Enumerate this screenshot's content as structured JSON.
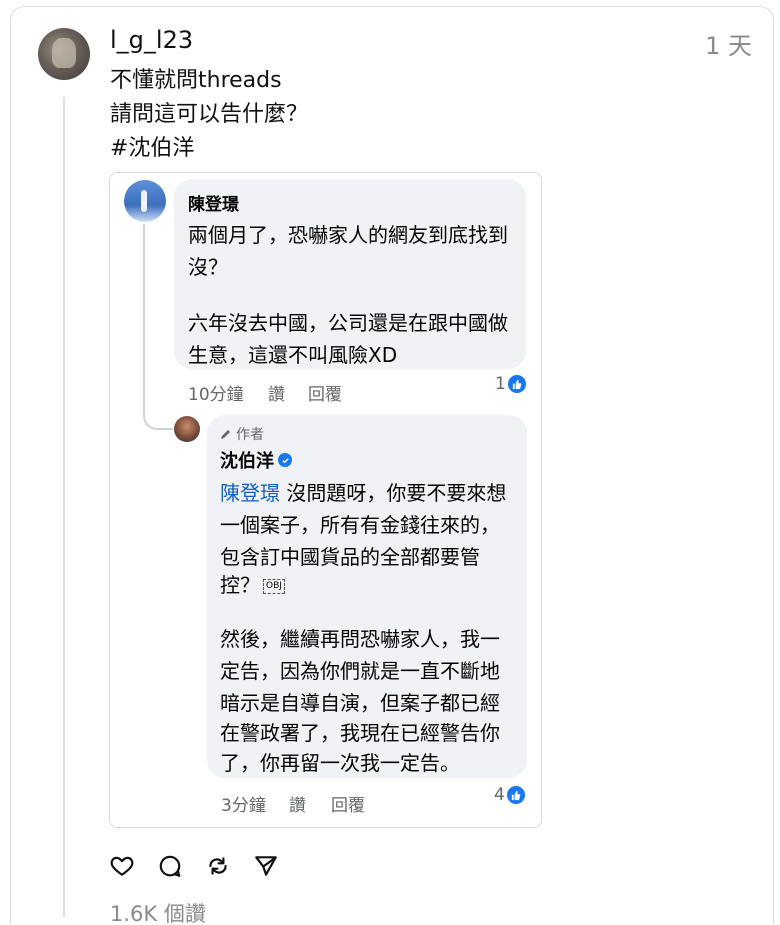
{
  "post": {
    "username": "l_g_l23",
    "time": "1 天",
    "lines": [
      "不懂就問threads",
      "請問這可以告什麼？",
      "#沈伯洋"
    ],
    "likes": "1.6K 個讚"
  },
  "comment1": {
    "name": "陳登璟",
    "lines": [
      "兩個月了，恐嚇家人的網友到底找到",
      "沒？",
      "六年沒去中國，公司還是在跟中國做",
      "生意，這還不叫風險XD"
    ],
    "time": "10分鐘",
    "like_label": "讚",
    "reply_label": "回覆",
    "reactions": "1"
  },
  "comment2": {
    "author_tag": "作者",
    "name": "沈伯洋",
    "mention": "陳登璟",
    "lines": [
      " 沒問題呀，你要不要來想",
      "一個案子，所有有金錢往來的，",
      "包含訂中國貨品的全部都要管",
      "控？",
      "然後，繼續再問恐嚇家人，我一",
      "定告，因為你們就是一直不斷地",
      "暗示是自導自演，但案子都已經",
      "在警政署了，我現在已經警告你",
      "了，你再留一次我一定告。"
    ],
    "obj": "OBJ",
    "time": "3分鐘",
    "like_label": "讚",
    "reply_label": "回覆",
    "reactions": "4"
  },
  "colors": {
    "accent": "#1877f2",
    "mention": "#0b5fc4",
    "bubble": "#f0f2f5"
  }
}
